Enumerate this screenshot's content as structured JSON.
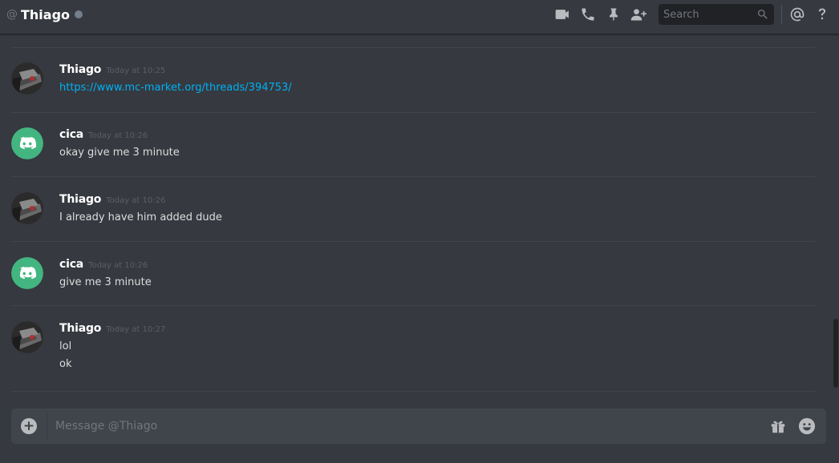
{
  "header": {
    "at_symbol": "@",
    "title": "Thiago",
    "search_placeholder": "Search",
    "icons": [
      "video-call-icon",
      "voice-call-icon",
      "pin-icon",
      "add-friend-icon",
      "search-icon",
      "mentions-icon",
      "help-icon"
    ]
  },
  "messages": [
    {
      "author": "Thiago",
      "time": "Today at 10:25",
      "lines": [
        "https://www.mc-market.org/threads/394753/"
      ],
      "avatar": "user-avatar"
    },
    {
      "author": "cica",
      "time": "Today at 10:26",
      "lines": [
        "okay give me 3 minute"
      ],
      "avatar": "discord-default-avatar"
    },
    {
      "author": "Thiago",
      "time": "Today at 10:26",
      "lines": [
        "I already have him added dude"
      ],
      "avatar": "user-avatar"
    },
    {
      "author": "cica",
      "time": "Today at 10:26",
      "lines": [
        "give me 3 minute"
      ],
      "avatar": "discord-default-avatar"
    },
    {
      "author": "Thiago",
      "time": "Today at 10:27",
      "lines": [
        "lol",
        "ok"
      ],
      "avatar": "user-avatar"
    }
  ],
  "composer": {
    "placeholder": "Message @Thiago",
    "add_symbol": "+",
    "icons": [
      "add-attachment-icon",
      "gift-icon",
      "emoji-icon"
    ]
  },
  "colors": {
    "background": "#36393f",
    "link": "#00b0f4",
    "discord_green": "#43b581",
    "offline_status": "#747f8d"
  }
}
